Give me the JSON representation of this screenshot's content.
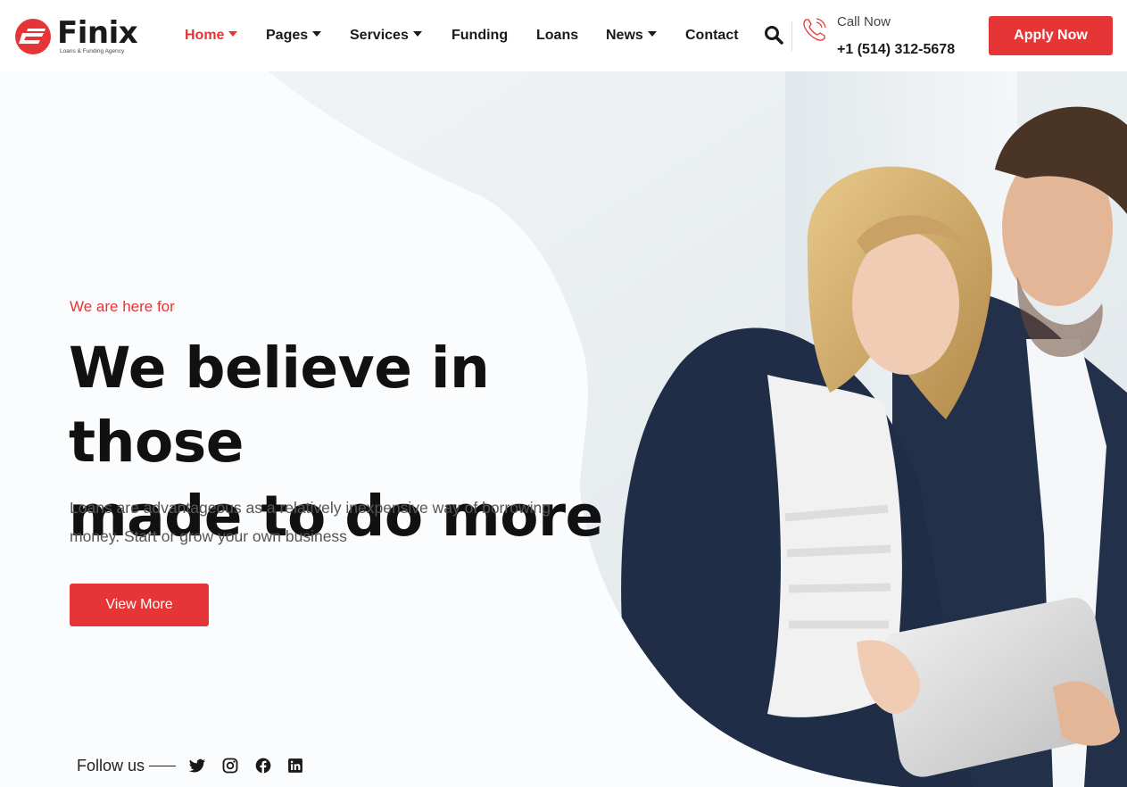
{
  "brand": {
    "name": "Finix",
    "tagline": "Loans & Funding Agency",
    "accent_color": "#e63537"
  },
  "nav": {
    "items": [
      {
        "label": "Home",
        "has_dropdown": true,
        "active": true
      },
      {
        "label": "Pages",
        "has_dropdown": true,
        "active": false
      },
      {
        "label": "Services",
        "has_dropdown": true,
        "active": false
      },
      {
        "label": "Funding",
        "has_dropdown": false,
        "active": false
      },
      {
        "label": "Loans",
        "has_dropdown": false,
        "active": false
      },
      {
        "label": "News",
        "has_dropdown": true,
        "active": false
      },
      {
        "label": "Contact",
        "has_dropdown": false,
        "active": false
      }
    ],
    "search_icon": "search-icon"
  },
  "contact": {
    "call_label": "Call Now",
    "phone": "+1 (514) 312-5678",
    "icon": "phone-icon"
  },
  "header": {
    "apply_label": "Apply Now"
  },
  "hero": {
    "eyebrow": "We are here for",
    "headline_line1": "We believe in those",
    "headline_line2": "made to do more",
    "lead": "Loans are advantageous as a relatively inexpensive way of borrowing money. Start or grow your own business",
    "cta_label": "View More"
  },
  "social": {
    "follow_label": "Follow us",
    "icons": [
      "twitter-icon",
      "instagram-icon",
      "facebook-icon",
      "linkedin-icon"
    ]
  }
}
